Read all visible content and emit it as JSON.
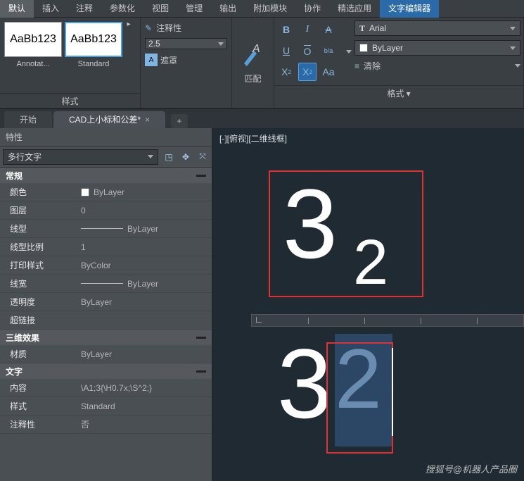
{
  "menu": {
    "items": [
      "默认",
      "插入",
      "注释",
      "参数化",
      "视图",
      "管理",
      "输出",
      "附加模块",
      "协作",
      "精选应用",
      "文字编辑器"
    ]
  },
  "ribbon": {
    "styles": {
      "sample": "AaBb123",
      "items": [
        "Annotat...",
        "Standard"
      ],
      "title": "样式"
    },
    "anno": {
      "label": "注释性",
      "scale": "2.5",
      "mask": "遮罩"
    },
    "match": {
      "label": "匹配"
    },
    "format": {
      "font": "Arial",
      "color": "ByLayer",
      "clear": "清除",
      "title": "格式 ▾"
    }
  },
  "tabs": {
    "items": [
      "开始",
      "CAD上小标和公差*"
    ]
  },
  "props": {
    "header": "特性",
    "selector": "多行文字",
    "sections": {
      "general": "常规",
      "effect": "三维效果",
      "text": "文字"
    },
    "general": [
      {
        "label": "颜色",
        "value": "ByLayer",
        "swatch": true
      },
      {
        "label": "图层",
        "value": "0"
      },
      {
        "label": "线型",
        "value": "ByLayer",
        "line": true
      },
      {
        "label": "线型比例",
        "value": "1"
      },
      {
        "label": "打印样式",
        "value": "ByColor"
      },
      {
        "label": "线宽",
        "value": "ByLayer",
        "line": true
      },
      {
        "label": "透明度",
        "value": "ByLayer"
      },
      {
        "label": "超链接",
        "value": ""
      }
    ],
    "effect": [
      {
        "label": "材质",
        "value": "ByLayer"
      }
    ],
    "text": [
      {
        "label": "内容",
        "value": "\\A1;3{\\H0.7x;\\S^2;}"
      },
      {
        "label": "样式",
        "value": "Standard"
      },
      {
        "label": "注释性",
        "value": "否"
      }
    ]
  },
  "canvas": {
    "view_label": "[-][俯视][二维线框]",
    "main_text": "3",
    "sub_text": "2"
  },
  "watermark": "搜狐号@机器人产品圈"
}
